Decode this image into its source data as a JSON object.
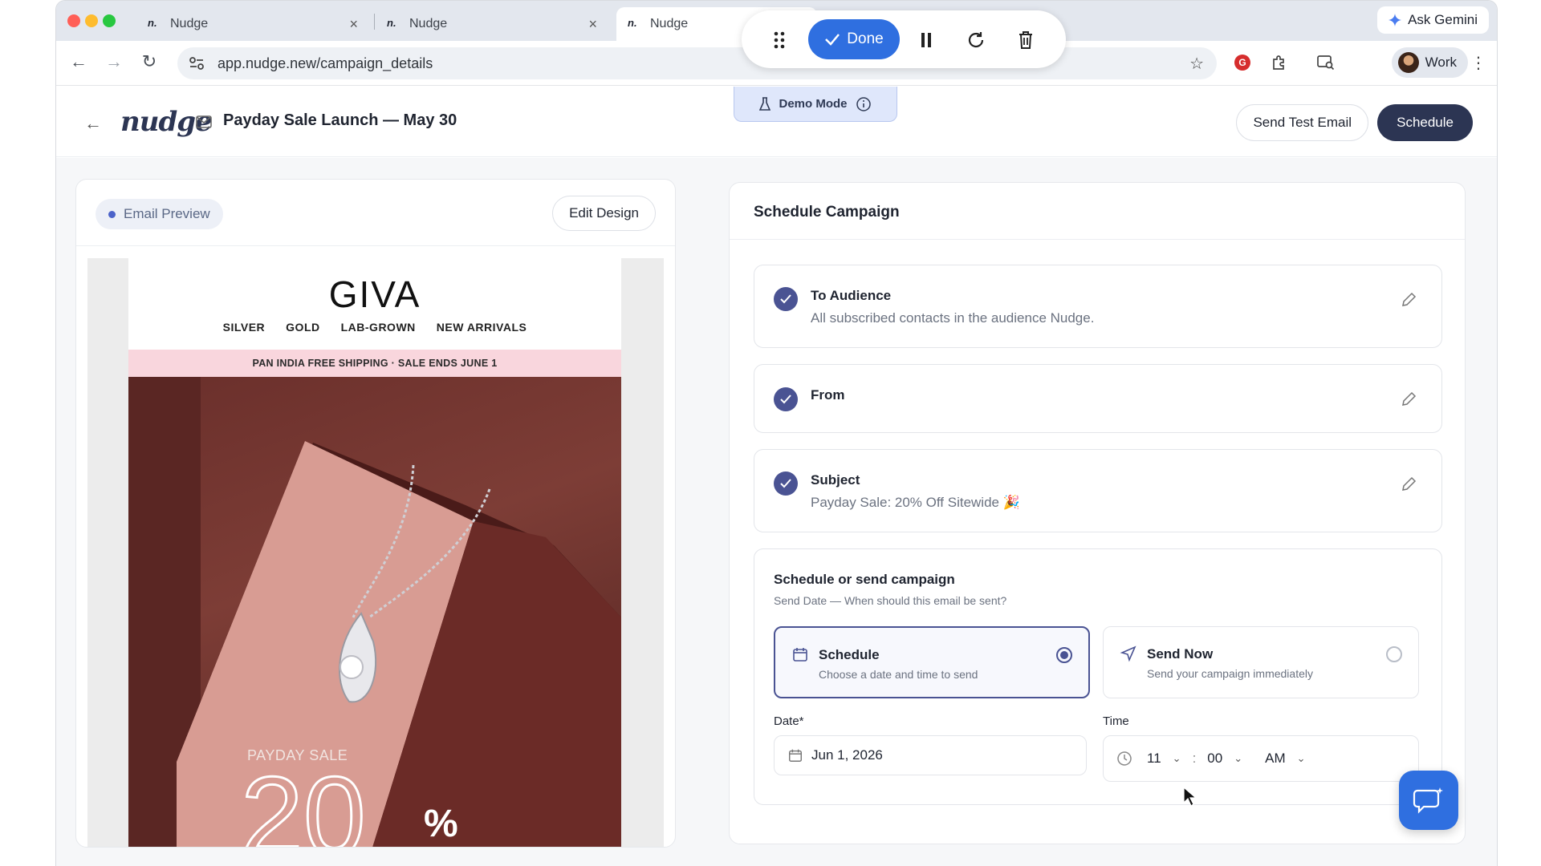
{
  "browser": {
    "tabs": [
      {
        "label": "Nudge"
      },
      {
        "label": "Nudge"
      },
      {
        "label": "Nudge"
      }
    ],
    "ask_gemini": "Ask Gemini",
    "url": "app.nudge.new/campaign_details",
    "profile": "Work"
  },
  "recorder": {
    "done_label": "Done"
  },
  "header": {
    "logo": "nudge",
    "campaign_title": "Payday Sale Launch — May 30",
    "demo_mode": "Demo Mode",
    "send_test_label": "Send Test Email",
    "schedule_label": "Schedule"
  },
  "preview": {
    "pill_label": "Email Preview",
    "edit_design_label": "Edit Design",
    "email": {
      "brand": "GIVA",
      "nav": [
        "SILVER",
        "GOLD",
        "LAB-GROWN",
        "NEW ARRIVALS"
      ],
      "promo": "PAN INDIA FREE SHIPPING · SALE ENDS JUNE 1",
      "hero_label": "PAYDAY SALE",
      "hero_number": "20",
      "hero_percent": "%"
    }
  },
  "schedule": {
    "title": "Schedule Campaign",
    "steps": [
      {
        "label": "To Audience",
        "sub": "All subscribed contacts in the audience Nudge."
      },
      {
        "label": "From",
        "sub": ""
      },
      {
        "label": "Subject",
        "sub": "Payday Sale: 20% Off Sitewide 🎉"
      }
    ],
    "box": {
      "title": "Schedule or send campaign",
      "subtitle": "Send Date — When should this email be sent?",
      "options": [
        {
          "title": "Schedule",
          "sub": "Choose a date and time to send",
          "selected": true
        },
        {
          "title": "Send Now",
          "sub": "Send your campaign immediately",
          "selected": false
        }
      ],
      "date_label": "Date*",
      "date_value": "Jun 1, 2026",
      "time_label": "Time",
      "hour": "11",
      "minute": "00",
      "ampm": "AM",
      "time_sep": ":"
    }
  },
  "colors": {
    "accent": "#4a5393",
    "primary_dark": "#2c3553",
    "blue": "#2f6fe0"
  }
}
